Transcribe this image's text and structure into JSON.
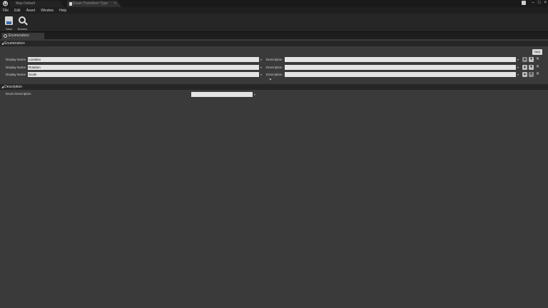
{
  "tabs": [
    {
      "label": "Map Default"
    },
    {
      "label": "Enum Transform Type"
    }
  ],
  "menu": [
    "File",
    "Edit",
    "Asset",
    "Window",
    "Help"
  ],
  "toolbar": {
    "save_label": "Save",
    "browse_label": "Browse"
  },
  "panel_tab": {
    "label": "Enumerators"
  },
  "enumerators_section": {
    "title": "Enumerators",
    "new_label": "New",
    "display_name_label": "Display Name",
    "description_label": "Description",
    "rows": [
      {
        "display_name": "Location",
        "description": ""
      },
      {
        "display_name": "Rotation",
        "description": ""
      },
      {
        "display_name": "Scale",
        "description": ""
      }
    ]
  },
  "description_section": {
    "title": "Description",
    "enum_description_label": "Enum Description",
    "enum_description_value": ""
  }
}
